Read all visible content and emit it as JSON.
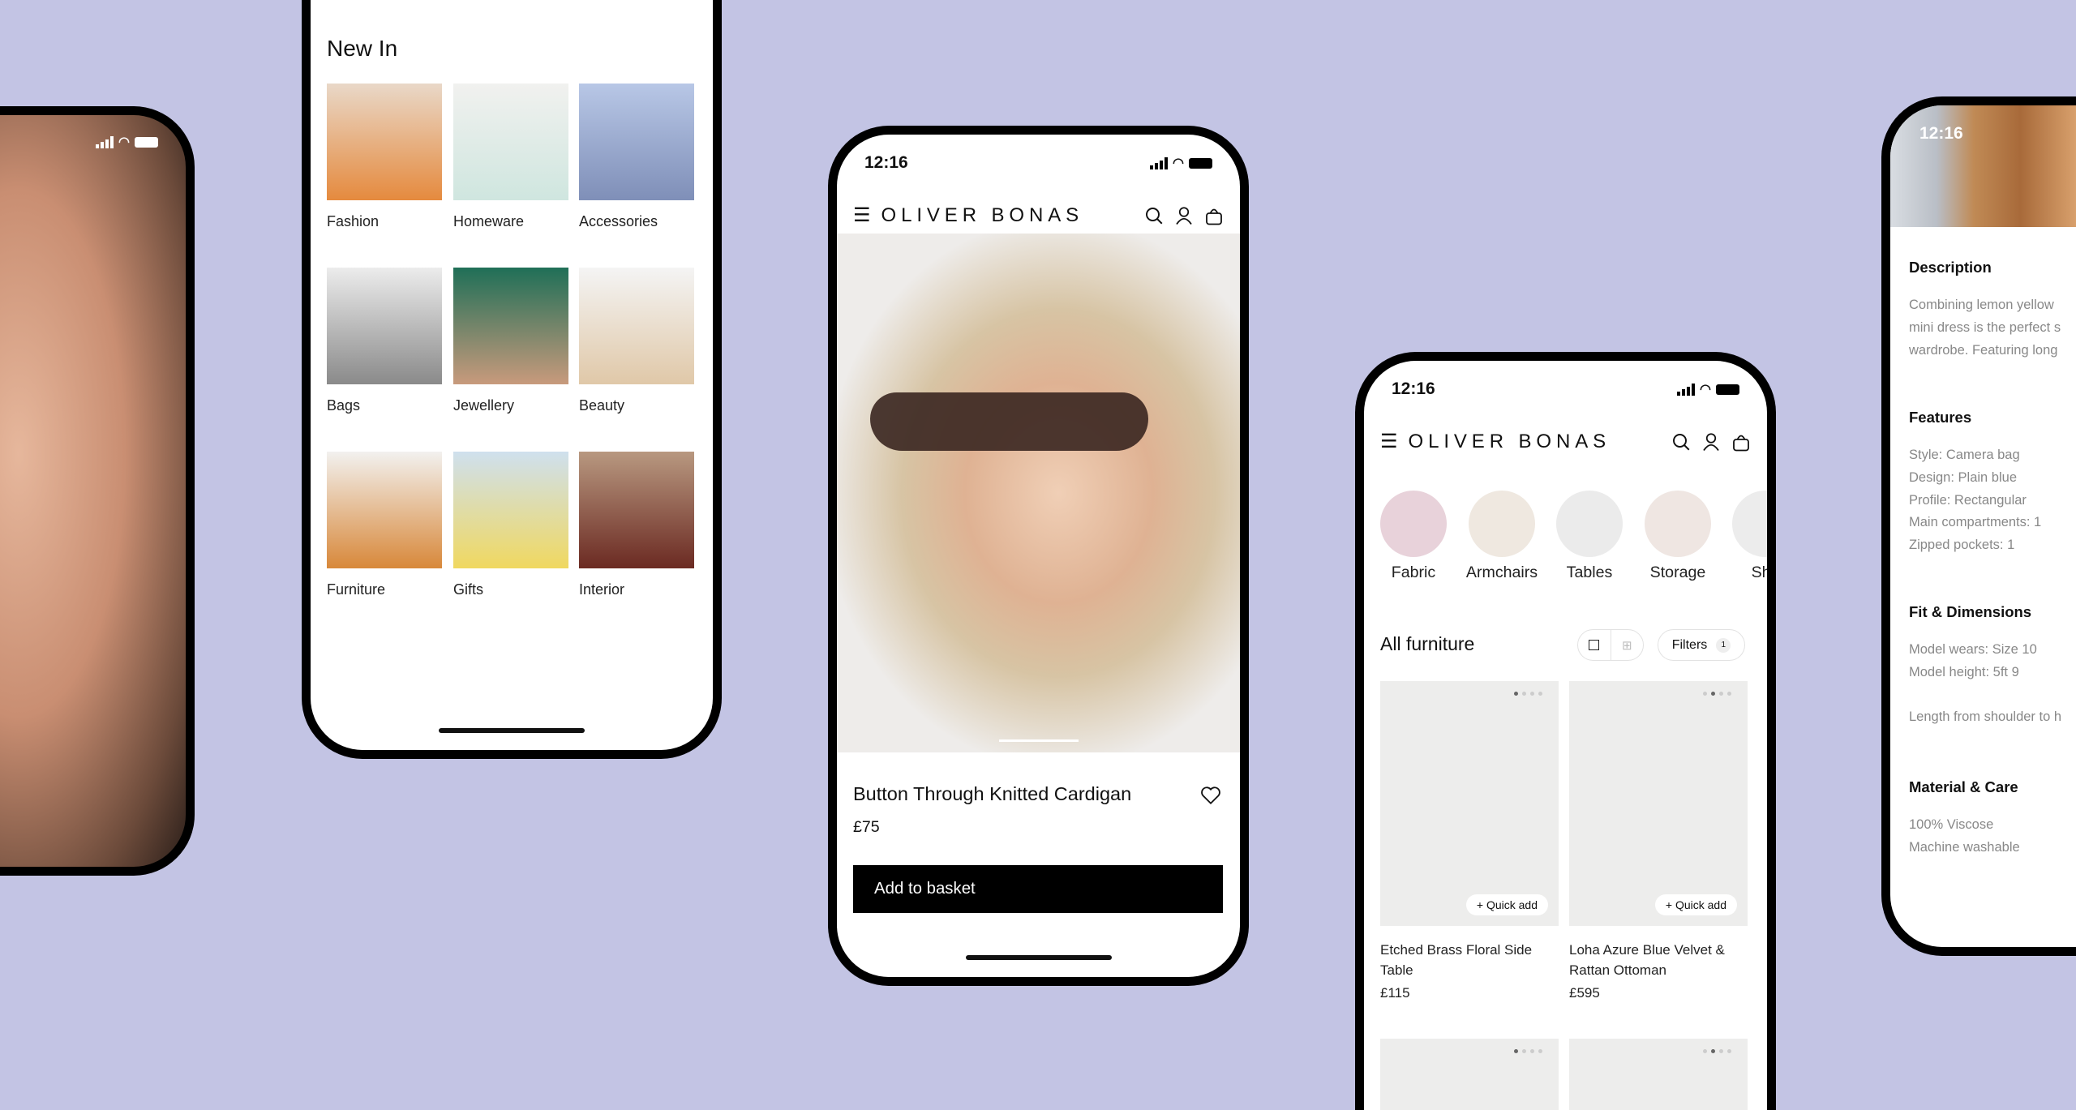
{
  "colors": {
    "background": "#c3c4e4",
    "button": "#000000",
    "accent_text": "#111111"
  },
  "status_bar": {
    "time": "12:16"
  },
  "brand": {
    "logo": "OLIVER BONAS"
  },
  "icons": [
    "menu-icon",
    "search-icon",
    "account-icon",
    "basket-icon",
    "heart-icon",
    "signal-icon",
    "wifi-icon",
    "battery-icon"
  ],
  "new_in": {
    "title": "New In",
    "categories": [
      "Fashion",
      "Homeware",
      "Accessories",
      "Bags",
      "Jewellery",
      "Beauty",
      "Furniture",
      "Gifts",
      "Interior"
    ]
  },
  "product": {
    "title": "Button Through Knitted Cardigan",
    "price": "£75",
    "add_button": "Add to basket"
  },
  "furniture": {
    "categories": [
      "Fabric",
      "Armchairs",
      "Tables",
      "Storage",
      "She"
    ],
    "heading": "All furniture",
    "filters_label": "Filters",
    "filters_count": "1",
    "quick_add": "+ Quick add",
    "products": [
      {
        "name": "Etched Brass Floral Side Table",
        "price": "£115"
      },
      {
        "name": "Loha Azure Blue Velvet & Rattan Ottoman",
        "price": "£595"
      }
    ]
  },
  "details": {
    "sections": [
      {
        "heading": "Description",
        "lines": [
          "Combining lemon yellow",
          "mini dress is the perfect s",
          "wardrobe. Featuring long"
        ]
      },
      {
        "heading": "Features",
        "lines": [
          "Style: Camera bag",
          "Design: Plain blue",
          "Profile: Rectangular",
          "Main compartments: 1",
          "Zipped pockets: 1"
        ]
      },
      {
        "heading": "Fit & Dimensions",
        "lines": [
          "Model wears: Size 10",
          "Model height: 5ft 9",
          "",
          "Length from shoulder to h"
        ]
      },
      {
        "heading": "Material & Care",
        "lines": [
          "100% Viscose",
          "Machine washable"
        ]
      }
    ]
  }
}
